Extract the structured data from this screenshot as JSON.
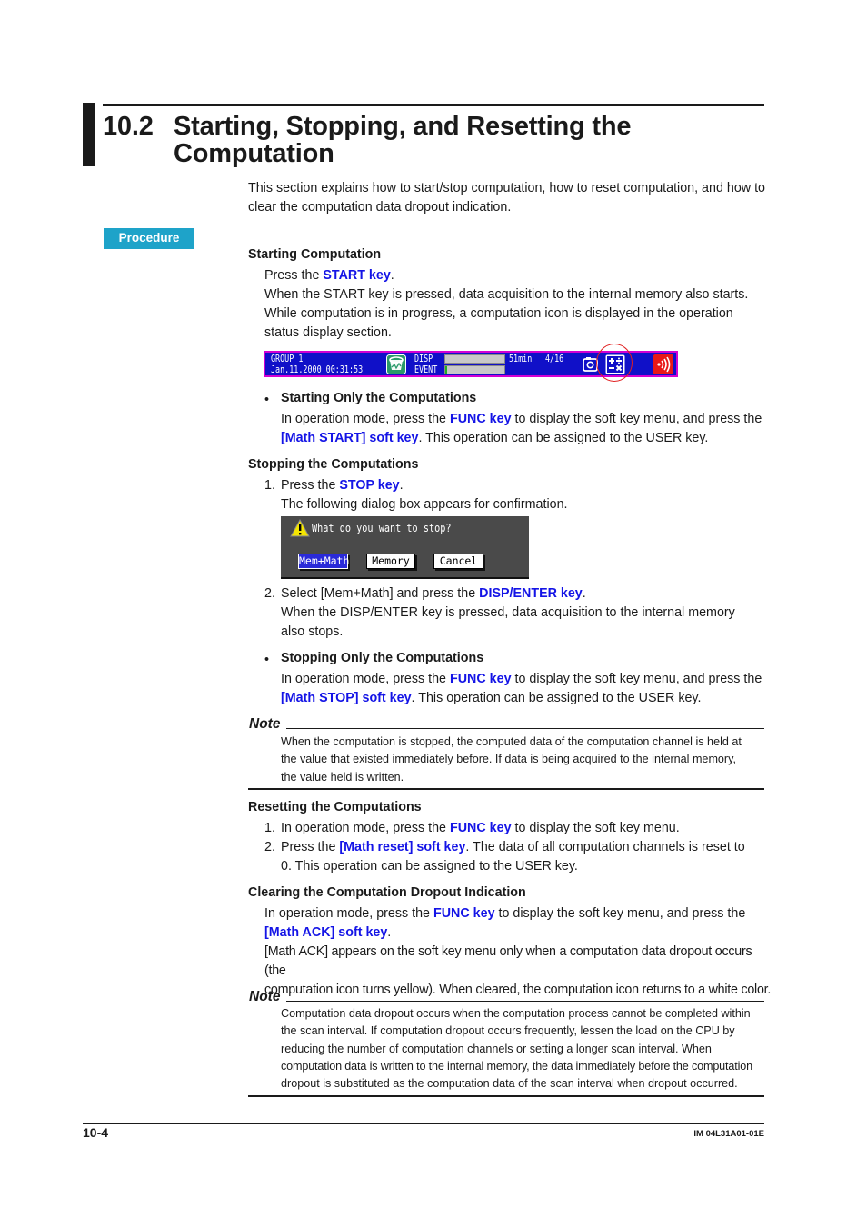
{
  "heading": {
    "number": "10.2",
    "title_line1": "Starting, Stopping, and Resetting the",
    "title_line2": "Computation"
  },
  "intro": "This section explains how to start/stop computation, how to reset computation, and how to clear the computation data dropout indication.",
  "procedure_label": "Procedure",
  "starting": {
    "title": "Starting Computation",
    "press_prefix": "Press the ",
    "press_key": "START key",
    "press_suffix": ".",
    "line2": "When the START key is pressed, data acquisition to the internal memory also starts.",
    "line3": "While computation is in progress, a computation icon is displayed in the operation",
    "line4": "status display section."
  },
  "status_bar": {
    "group": "GROUP 1",
    "datetime": "Jan.11.2000 00:31:53",
    "disp_label": "DISP",
    "event_label": "EVENT",
    "remaining": "51min",
    "page": "4/16",
    "disp_fill": 0,
    "event_fill": 0.02,
    "icons": [
      "memory-icon",
      "camera-icon",
      "computation-icon",
      "communication-icon"
    ],
    "colors": {
      "background": "#1010c8",
      "border": "#d200d2",
      "highlight": "#e02020"
    }
  },
  "starting_only": {
    "bullet": "•",
    "title": "Starting Only the Computations",
    "t1": "In operation mode, press the ",
    "k1": "FUNC key",
    "t2": " to display the soft key menu, and press the",
    "k2": "[Math START] soft key",
    "t3": ".  This operation can be assigned to the USER key."
  },
  "stopping": {
    "title": "Stopping the Computations",
    "step1_num": "1.",
    "step1_prefix": "Press the ",
    "step1_key": "STOP key",
    "step1_suffix": ".",
    "step1_line2": "The following dialog box appears for confirmation.",
    "step2_num": "2.",
    "step2_prefix": "Select [Mem+Math] and press the ",
    "step2_key": "DISP/ENTER key",
    "step2_suffix": ".",
    "step2_line2": "When the DISP/ENTER key is pressed, data acquisition to the internal memory",
    "step2_line3": "also stops."
  },
  "dialog": {
    "message": "What do you want to stop?",
    "buttons": [
      "Mem+Math",
      "Memory",
      "Cancel"
    ],
    "selected": "Mem+Math"
  },
  "stopping_only": {
    "bullet": "•",
    "title": "Stopping Only the Computations",
    "t1": "In operation mode, press the ",
    "k1": "FUNC key",
    "t2": " to display the soft key menu, and press the",
    "k2": "[Math STOP] soft key",
    "t3": ".  This operation can be assigned to the USER key."
  },
  "note1": {
    "label": "Note",
    "line1": "When the computation is stopped, the computed data of the computation channel is held at",
    "line2": "the value that existed immediately before.  If data is being acquired to the internal memory,",
    "line3": "the value held is written."
  },
  "resetting": {
    "title": "Resetting the Computations",
    "step1_num": "1.",
    "step1_prefix": "In operation mode, press the ",
    "step1_key": "FUNC key",
    "step1_suffix": " to display the soft key menu.",
    "step2_num": "2.",
    "step2_prefix": "Press the ",
    "step2_key": "[Math reset] soft key",
    "step2_suffix": ".  The data of all computation channels is reset to",
    "step2_line2": "0.  This operation can be assigned to the USER key."
  },
  "clearing": {
    "title": "Clearing the Computation Dropout Indication",
    "t1": "In operation mode, press the ",
    "k1": "FUNC key",
    "t2": " to display the soft key menu, and press the",
    "k2": "[Math ACK] soft key",
    "t3": ".",
    "line3": "[Math ACK] appears on the soft key menu only when a computation data dropout occurs (the",
    "line4": "computation icon turns yellow).  When cleared, the computation icon returns to a white color."
  },
  "note2": {
    "label": "Note",
    "line1": "Computation data dropout occurs when the computation process cannot be completed within",
    "line2": "the scan interval.  If computation dropout occurs frequently, lessen the load on the CPU by",
    "line3": "reducing the number of computation channels or setting a longer scan interval.  When",
    "line4": "computation data is written to the internal memory, the data immediately before the computation",
    "line5": "dropout is substituted as the computation data of the scan interval when dropout occurred."
  },
  "footer": {
    "page": "10-4",
    "doc_id": "IM 04L31A01-01E"
  },
  "colors": {
    "key_text": "#1414e6",
    "procedure_badge": "#1ea3c9"
  }
}
